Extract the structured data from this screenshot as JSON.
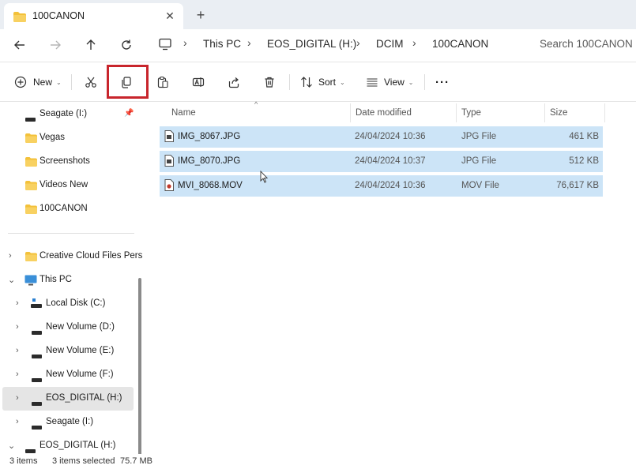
{
  "tab": {
    "title": "100CANON",
    "close_glyph": "✕",
    "new_tab_glyph": "+"
  },
  "breadcrumb": [
    "This PC",
    "EOS_DIGITAL (H:)",
    "DCIM",
    "100CANON"
  ],
  "search": {
    "placeholder": "Search 100CANON"
  },
  "commands": {
    "new_label": "New",
    "sort_label": "Sort",
    "view_label": "View",
    "more_glyph": "···"
  },
  "sidebar": {
    "items": [
      {
        "label": "Seagate (I:)",
        "icon": "drive-icon",
        "pinned": true
      },
      {
        "label": "Vegas",
        "icon": "folder-icon"
      },
      {
        "label": "Screenshots",
        "icon": "folder-icon"
      },
      {
        "label": "Videos New",
        "icon": "folder-icon"
      },
      {
        "label": "100CANON",
        "icon": "folder-icon"
      },
      {
        "label": "Creative Cloud Files Pers",
        "icon": "folder-icon",
        "expandable": true
      },
      {
        "label": "This PC",
        "icon": "computer-icon",
        "expanded": true
      },
      {
        "label": "Local Disk (C:)",
        "icon": "system-drive-icon",
        "expandable": true
      },
      {
        "label": "New Volume (D:)",
        "icon": "drive-icon",
        "expandable": true
      },
      {
        "label": "New Volume (E:)",
        "icon": "drive-icon",
        "expandable": true
      },
      {
        "label": "New Volume (F:)",
        "icon": "drive-icon",
        "expandable": true
      },
      {
        "label": "EOS_DIGITAL (H:)",
        "icon": "drive-icon",
        "expandable": true,
        "selected": true
      },
      {
        "label": "Seagate (I:)",
        "icon": "drive-icon",
        "expandable": true
      },
      {
        "label": "EOS_DIGITAL (H:)",
        "icon": "drive-icon",
        "expanded": true
      }
    ]
  },
  "columns": {
    "name": "Name",
    "date": "Date modified",
    "type": "Type",
    "size": "Size"
  },
  "files": [
    {
      "name": "IMG_8067.JPG",
      "date": "24/04/2024 10:36",
      "type": "JPG File",
      "size": "461 KB",
      "icon": "image-file-icon"
    },
    {
      "name": "IMG_8070.JPG",
      "date": "24/04/2024 10:37",
      "type": "JPG File",
      "size": "512 KB",
      "icon": "image-file-icon"
    },
    {
      "name": "MVI_8068.MOV",
      "date": "24/04/2024 10:36",
      "type": "MOV File",
      "size": "76,617 KB",
      "icon": "video-file-icon"
    }
  ],
  "status": {
    "count": "3 items",
    "selected": "3 items selected",
    "size": "75.7 MB"
  },
  "colors": {
    "selection": "#cce4f7",
    "highlight_box": "#c8252c",
    "accent": "#0067c0",
    "folder": "#f3c13a"
  }
}
